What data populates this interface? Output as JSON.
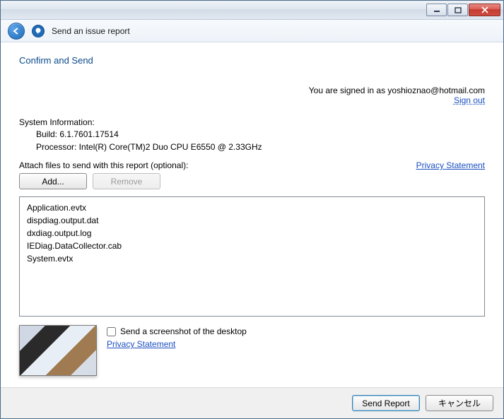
{
  "window": {
    "title": "Send an issue report"
  },
  "page": {
    "heading": "Confirm and Send",
    "signedInPrefix": "You are signed in as ",
    "signedInEmail": "yoshioznao@hotmail.com",
    "signOut": "Sign out"
  },
  "system": {
    "label": "System Information:",
    "build": "Build: 6.1.7601.17514",
    "processor": "Processor: Intel(R) Core(TM)2 Duo CPU     E6550  @ 2.33GHz"
  },
  "attach": {
    "label": "Attach files to send with this report (optional):",
    "privacy": "Privacy Statement",
    "addButton": "Add...",
    "removeButton": "Remove",
    "files": [
      "Application.evtx",
      "dispdiag.output.dat",
      "dxdiag.output.log",
      "IEDiag.DataCollector.cab",
      "System.evtx"
    ]
  },
  "screenshot": {
    "checkboxLabel": "Send a screenshot of the desktop",
    "privacy": "Privacy Statement",
    "checked": false
  },
  "footer": {
    "send": "Send Report",
    "cancel": "キャンセル"
  }
}
